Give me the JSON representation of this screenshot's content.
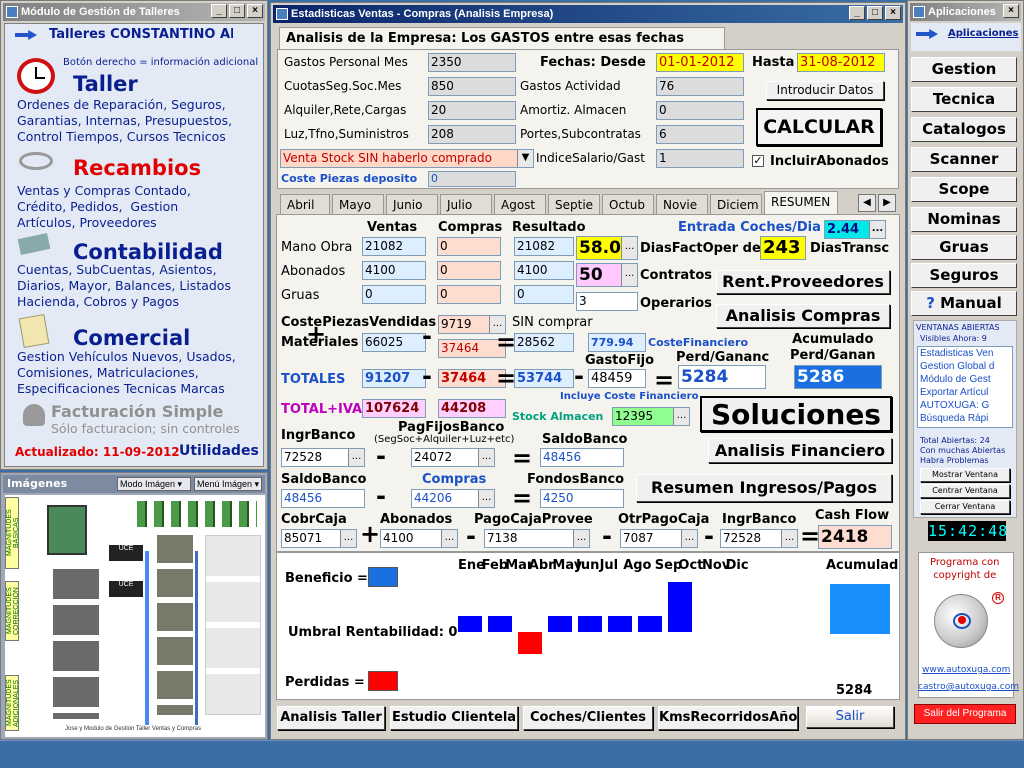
{
  "left_window": {
    "title": "Módulo de Gestión de Talleres",
    "header": "Talleres CONSTANTINO AM",
    "hint": "Botón derecho = información adicional",
    "sections": [
      {
        "title": "Taller",
        "text": "Ordenes de Reparación, Seguros,\nGarantias, Internas, Presupuestos,\nControl Tiempos, Cursos Tecnicos",
        "color": "#0a1f8f"
      },
      {
        "title": "Recambios",
        "text": "Ventas y Compras Contado,\nCrédito, Pedidos,  Gestion\nArtículos, Proveedores",
        "color": "#e00000"
      },
      {
        "title": "Contabilidad",
        "text": "Cuentas, SubCuentas, Asientos,\nDiarios, Mayor, Balances, Listados\nHacienda, Cobros y Pagos",
        "color": "#0a1f8f"
      },
      {
        "title": "Comercial",
        "text": "Gestion Vehículos Nuevos, Usados,\nComisiones, Matriculaciones,\nEspecificaciones Tecnicas Marcas",
        "color": "#0a1f8f"
      }
    ],
    "fact_title": "Facturación Simple",
    "fact_sub": "Sólo facturacion; sin controles",
    "updated": "Actualizado: 11-09-2012",
    "utilidades": "Utilidades"
  },
  "images_window": {
    "title": "Imágenes",
    "mode_label": "Modo Imágen",
    "menu_label": "Menú Imágen",
    "side_labels": [
      "MAGNITUDES BÁSICAS",
      "MAGNITUDES CORRECCIÓN",
      "MAGNITUDES ADICIONALES"
    ],
    "caption": "Jose y Modulo de Gestion Taller Ventas y Compras"
  },
  "main": {
    "title": "Estadisticas Ventas - Compras (Analisis Empresa)",
    "tab_title": "Analisis de la Empresa: Los GASTOS entre esas fechas eran:",
    "gastos": [
      {
        "label": "Gastos Personal Mes",
        "value": "2350"
      },
      {
        "label": "CuotasSeg.Soc.Mes",
        "value": "850"
      },
      {
        "label": "Alquiler,Rete,Cargas",
        "value": "20"
      },
      {
        "label": "Luz,Tfno,Suministros",
        "value": "208"
      }
    ],
    "gastos2": [
      {
        "label": "Gastos Actividad",
        "value": "76"
      },
      {
        "label": "Amortiz. Almacen",
        "value": "0"
      },
      {
        "label": "Portes,Subcontratas",
        "value": "6"
      },
      {
        "label": "IndiceSalario/Gast",
        "value": "1"
      }
    ],
    "fechas_label": "Fechas: Desde",
    "desde": "01-01-2012",
    "hasta_label": "Hasta",
    "hasta": "31-08-2012",
    "introducir": "Introducir Datos",
    "calcular": "CALCULAR",
    "incluir": "IncluirAbonados",
    "venta_stock": "Venta Stock SIN haberlo comprado",
    "coste_piezas_label": "Coste Piezas deposito",
    "coste_piezas": "0",
    "months": [
      "Abril",
      "Mayo",
      "Junio",
      "Julio",
      "Agost",
      "Septie",
      "Octub",
      "Novie",
      "Diciem",
      "RESUMEN"
    ],
    "col_ventas": "Ventas",
    "col_compras": "Compras",
    "col_resultado": "Resultado",
    "rows": [
      {
        "label": "Mano Obra",
        "ventas": "21082",
        "compras": "0",
        "resultado": "21082"
      },
      {
        "label": "Abonados",
        "ventas": "4100",
        "compras": "0",
        "resultado": "4100"
      },
      {
        "label": "Gruas",
        "ventas": "0",
        "compras": "0",
        "resultado": "0"
      }
    ],
    "entrada_label": "Entrada Coches/Dia",
    "entrada": "2.44",
    "dias_fact": "58.0",
    "dias_fact_label": "DiasFactOper de",
    "dias_transc": "243",
    "dias_transc_label": "DiasTransc",
    "contratos": "50",
    "contratos_label": "Contratos",
    "operarios": "3",
    "operarios_label": "Operarios",
    "rent_prov": "Rent.Proveedores",
    "analisis_compras": "Analisis Compras",
    "coste_vendidas_label": "CostePiezasVendidas",
    "coste_vendidas": "9719",
    "sin_comprar_label": "SIN comprar",
    "materiales_label": "Materiales",
    "materiales": "66025",
    "materiales_compras": "37464",
    "materiales_res": "28562",
    "coste_fin": "779.94",
    "coste_fin_label": "CosteFinanciero",
    "gasto_fijo_label": "GastoFijo",
    "perd_gan_label": "Perd/Gananc",
    "acum_label": "Acumulado\nPerd/Ganan",
    "totales_label": "TOTALES",
    "totales_v": "91207",
    "totales_c": "37464",
    "totales_r": "53744",
    "gasto_fijo": "48459",
    "perd_gan": "5284",
    "acumulado": "5286",
    "incluye": "Incluye Coste Financiero",
    "total_iva_label": "TOTAL+IVA",
    "total_iva_v": "107624",
    "total_iva_c": "44208",
    "stock_label": "Stock Almacen",
    "stock": "12395",
    "soluciones": "Soluciones",
    "ingr_banco_label": "IngrBanco",
    "ingr_banco": "72528",
    "pag_fijos_label": "PagFijosBanco",
    "pag_fijos_sub": "(SegSoc+Alquiler+Luz+etc)",
    "pag_fijos": "24072",
    "saldo_banco_label": "SaldoBanco",
    "saldo_banco": "48456",
    "analisis_fin": "Analisis Financiero",
    "saldo2_label": "SaldoBanco",
    "saldo2": "48456",
    "compras_label": "Compras",
    "compras2": "44206",
    "fondos_label": "FondosBanco",
    "fondos": "4250",
    "resumen_ip": "Resumen Ingresos/Pagos",
    "cobr_label": "CobrCaja",
    "cobr": "85071",
    "abon_label": "Abonados",
    "abon": "4100",
    "pago_prov_label": "PagoCajaProvee",
    "pago_prov": "7138",
    "otr_label": "OtrPagoCaja",
    "otr": "7087",
    "ingr2_label": "IngrBanco",
    "ingr2": "72528",
    "cash_label": "Cash Flow",
    "cash": "2418",
    "chart_labels": {
      "beneficio": "Beneficio =",
      "umbral": "Umbral Rentabilidad: 0",
      "perdidas": "Perdidas =",
      "acumulado": "Acumulad",
      "total": "5284"
    },
    "bottom_buttons": [
      "Analisis Taller",
      "Estudio Clientela",
      "Coches/Clientes",
      "KmsRecorridosAño"
    ],
    "salir": "Salir"
  },
  "chart_data": {
    "type": "bar",
    "categories": [
      "Ene",
      "Feb",
      "Mar",
      "Abr",
      "May",
      "Jun",
      "Jul",
      "Ago",
      "Sep",
      "Oct",
      "Nov",
      "Dic"
    ],
    "values": [
      1,
      1,
      -1,
      1,
      1,
      1,
      1,
      2,
      null,
      null,
      null,
      null
    ],
    "acumulado": 5284,
    "title": "",
    "ylabel": ""
  },
  "right_window": {
    "title": "Aplicaciones",
    "header": "Aplicaciones",
    "buttons": [
      "Gestion",
      "Tecnica",
      "Catalogos",
      "Scanner",
      "Scope",
      "Nominas",
      "Gruas",
      "Seguros",
      "Manual"
    ],
    "open_title": "VENTANAS ABIERTAS",
    "open_visible": "Visibles Ahora: 9",
    "open_list": [
      "Estadisticas Ven",
      "Gestion Global d",
      "Módulo de Gest",
      "Exportar Artícul",
      "AUTOXUGA: G",
      "Búsqueda Rápi"
    ],
    "total_open": "Total Abiertas: 24\nCon muchas Abiertas\nHabra Problemas",
    "mostrar": "Mostrar Ventana",
    "centrar": "Centrar Ventana",
    "cerrar": "Cerrar Ventana",
    "clock": "15:42:48",
    "copyright": "Programa con\ncopyright de",
    "web": "www.autoxuga.com",
    "email": "castro@autoxuga.com",
    "salir_programa": "Salir del Programa"
  }
}
